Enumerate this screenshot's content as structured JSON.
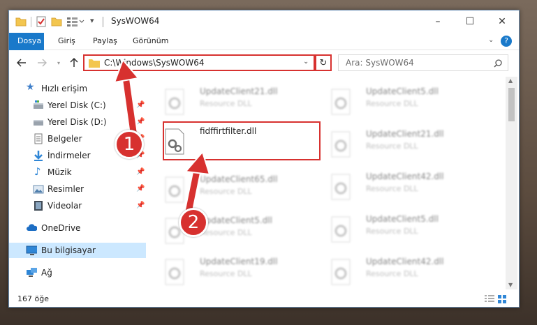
{
  "window": {
    "title": "SysWOW64",
    "controls": {
      "minimize": "–",
      "maximize": "☐",
      "close": "✕"
    }
  },
  "ribbon": {
    "tabs": [
      {
        "label": "Dosya"
      },
      {
        "label": "Giriş"
      },
      {
        "label": "Paylaş"
      },
      {
        "label": "Görünüm"
      }
    ]
  },
  "address": {
    "path": "C:\\Windows\\SysWOW64",
    "search_placeholder": "Ara: SysWOW64"
  },
  "nav": {
    "items": [
      {
        "label": "Hızlı erişim",
        "icon": "star-icon"
      },
      {
        "label": "Yerel Disk (C:)",
        "icon": "drive-icon"
      },
      {
        "label": "Yerel Disk (D:)",
        "icon": "drive-icon"
      },
      {
        "label": "Belgeler",
        "icon": "documents-icon"
      },
      {
        "label": "İndirmeler",
        "icon": "download-icon"
      },
      {
        "label": "Müzik",
        "icon": "music-icon"
      },
      {
        "label": "Resimler",
        "icon": "pictures-icon"
      },
      {
        "label": "Videolar",
        "icon": "videos-icon"
      },
      {
        "label": "OneDrive",
        "icon": "cloud-icon"
      },
      {
        "label": "Bu bilgisayar",
        "icon": "computer-icon"
      },
      {
        "label": "Ağ",
        "icon": "network-icon"
      }
    ]
  },
  "files": {
    "col1": [
      {
        "name": "UpdateClient21.dll",
        "type": "Resource DLL"
      },
      {
        "name": "fidffirtfilter.dll",
        "type": ""
      },
      {
        "name": "UpdateClient65.dll",
        "type": "Resource DLL"
      },
      {
        "name": "UpdateClient5.dll",
        "type": "Resource DLL"
      },
      {
        "name": "UpdateClient19.dll",
        "type": "Resource DLL"
      }
    ],
    "col2": [
      {
        "name": "UpdateClient5.dll",
        "type": "Resource DLL"
      },
      {
        "name": "UpdateClient21.dll",
        "type": "Resource DLL"
      },
      {
        "name": "UpdateClient42.dll",
        "type": "Resource DLL"
      },
      {
        "name": "UpdateClient5.dll",
        "type": "Resource DLL"
      },
      {
        "name": "UpdateClient42.dll",
        "type": "Resource DLL"
      }
    ]
  },
  "status": {
    "count": "167 öğe"
  },
  "annotations": {
    "step1": "1",
    "step2": "2"
  },
  "colors": {
    "accent": "#1979ca",
    "highlight": "#d7312f",
    "selected": "#cce8ff"
  }
}
